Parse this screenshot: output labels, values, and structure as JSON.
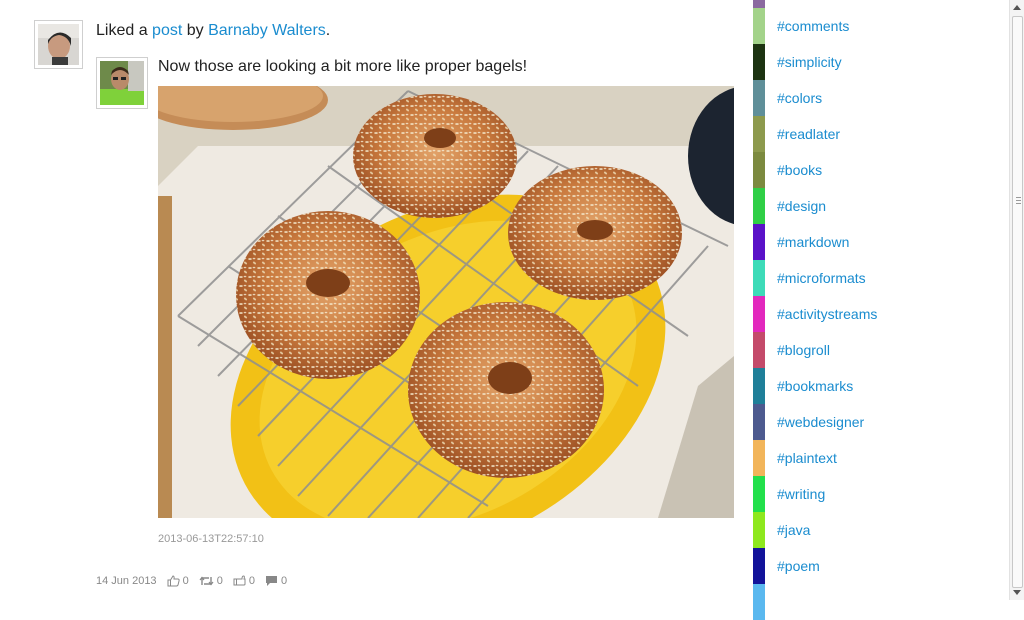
{
  "post": {
    "liked_prefix": "Liked a ",
    "post_link": "post",
    "by_text": " by ",
    "author_name": "Barnaby Walters",
    "period": ".",
    "text": "Now those are looking a bit more like proper bagels!",
    "permalink_time": "2013-06-13T22:57:10",
    "date": "14 Jun 2013",
    "likes": "0",
    "reposts": "0",
    "dislikes": "0",
    "comments": "0"
  },
  "tags": [
    {
      "label": "#comments",
      "color": "#a3d38a"
    },
    {
      "label": "#simplicity",
      "color": "#1d3412"
    },
    {
      "label": "#colors",
      "color": "#5f8f99"
    },
    {
      "label": "#readlater",
      "color": "#8d9a4d"
    },
    {
      "label": "#books",
      "color": "#7c8a3f"
    },
    {
      "label": "#design",
      "color": "#2fcf46"
    },
    {
      "label": "#markdown",
      "color": "#5a12c8"
    },
    {
      "label": "#microformats",
      "color": "#3ddbb8"
    },
    {
      "label": "#activitystreams",
      "color": "#e228bd"
    },
    {
      "label": "#blogroll",
      "color": "#c44a6a"
    },
    {
      "label": "#bookmarks",
      "color": "#1f7f99"
    },
    {
      "label": "#webdesigner",
      "color": "#4d5a8f"
    },
    {
      "label": "#plaintext",
      "color": "#f2b55a"
    },
    {
      "label": "#writing",
      "color": "#22e04b"
    },
    {
      "label": "#java",
      "color": "#8ee81e"
    },
    {
      "label": "#poem",
      "color": "#12139a"
    }
  ]
}
